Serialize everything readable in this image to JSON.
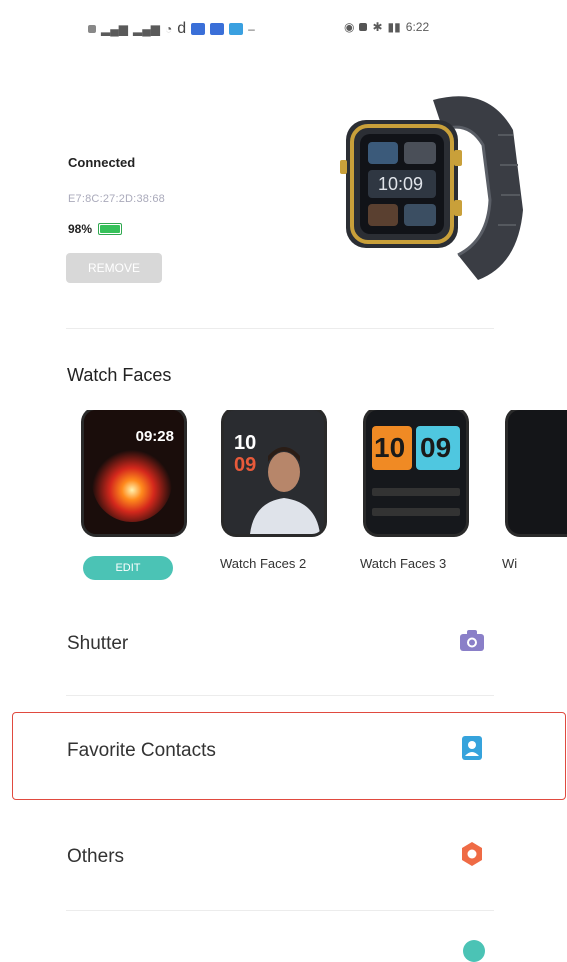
{
  "status_bar": {
    "time": "6:22",
    "network": "d"
  },
  "device": {
    "status": "Connected",
    "mac": "E7:8C:27:2D:38:68",
    "battery_text": "98%",
    "battery_level": 0.98,
    "remove_label": "REMOVE"
  },
  "watch_faces": {
    "title": "Watch Faces",
    "face1": {
      "time_big": "09:28",
      "edit_label": "EDIT"
    },
    "face2": {
      "hour": "10",
      "minute": "09",
      "label": "Watch Faces 2"
    },
    "face3": {
      "hour": "10",
      "minute": "09",
      "label": "Watch Faces 3"
    },
    "face4": {
      "label": "Wi"
    }
  },
  "menu": {
    "shutter": "Shutter",
    "favorite_contacts": "Favorite Contacts",
    "others": "Others"
  },
  "icons": {
    "shutter": "camera-icon",
    "contacts": "contact-card-icon",
    "others": "gear-icon"
  },
  "colors": {
    "accent_teal": "#4bc3b5",
    "camera_purple": "#8a7fc8",
    "contact_blue": "#36a3dc",
    "others_orange": "#ef6b45",
    "highlight_red": "#e04a3f"
  }
}
